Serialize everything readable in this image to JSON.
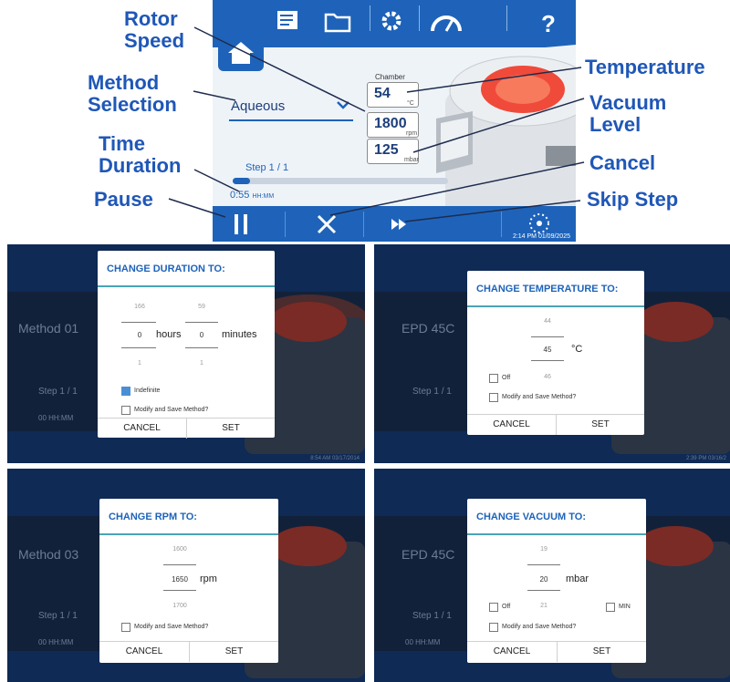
{
  "callouts": {
    "rotor": [
      "Rotor",
      "Speed"
    ],
    "method": [
      "Method",
      "Selection"
    ],
    "time": [
      "Time",
      "Duration"
    ],
    "pause": "Pause",
    "temperature": "Temperature",
    "vacuum": [
      "Vacuum",
      "Level"
    ],
    "cancel": "Cancel",
    "skip": "Skip Step"
  },
  "screen": {
    "method": "Aqueous",
    "chamber_label": "Chamber",
    "temp_value": "54",
    "temp_unit": "°C",
    "rpm_value": "1800",
    "rpm_unit": "rpm",
    "vacuum_value": "125",
    "vacuum_unit": "mbar",
    "step": "Step 1 / 1",
    "progress": 0.08,
    "time_value": "0:55",
    "time_unit": "HH:MM",
    "datetime": "2:14 PM 01/09/2025"
  },
  "dialogs": {
    "duration": {
      "bg_method": "Method 01",
      "bg_step": "Step 1 / 1",
      "bg_time": "00 HH:MM",
      "bg_datetime": "8:54 AM 03/17/2014",
      "title": "CHANGE DURATION TO:",
      "hours_prev": "166",
      "hours_cur": "0",
      "hours_next": "1",
      "hours_label": "hours",
      "min_prev": "59",
      "min_cur": "0",
      "min_next": "1",
      "min_label": "minutes",
      "indefinite": "Indefinite",
      "modify": "Modify and Save Method?",
      "cancel": "CANCEL",
      "set": "SET"
    },
    "temperature": {
      "bg_method": "EPD 45C",
      "bg_step": "Step 1 / 1",
      "bg_datetime": "2:39 PM 03/16/2",
      "title": "CHANGE TEMPERATURE TO:",
      "prev": "44",
      "cur": "45",
      "next": "46",
      "unit": "°C",
      "off": "Off",
      "modify": "Modify and Save Method?",
      "cancel": "CANCEL",
      "set": "SET"
    },
    "rpm": {
      "bg_method": "Method 03",
      "bg_step": "Step 1 / 1",
      "bg_time": "00 HH:MM",
      "title": "CHANGE RPM TO:",
      "prev": "1600",
      "cur": "1650",
      "next": "1700",
      "unit": "rpm",
      "modify": "Modify and Save Method?",
      "cancel": "CANCEL",
      "set": "SET"
    },
    "vacuum": {
      "bg_method": "EPD 45C",
      "bg_step": "Step 1 / 1",
      "bg_time": "00 HH:MM",
      "title": "CHANGE VACUUM TO:",
      "prev": "19",
      "cur": "20",
      "next": "21",
      "unit": "mbar",
      "off": "Off",
      "min": "MIN",
      "modify": "Modify and Save Method?",
      "cancel": "CANCEL",
      "set": "SET"
    }
  }
}
